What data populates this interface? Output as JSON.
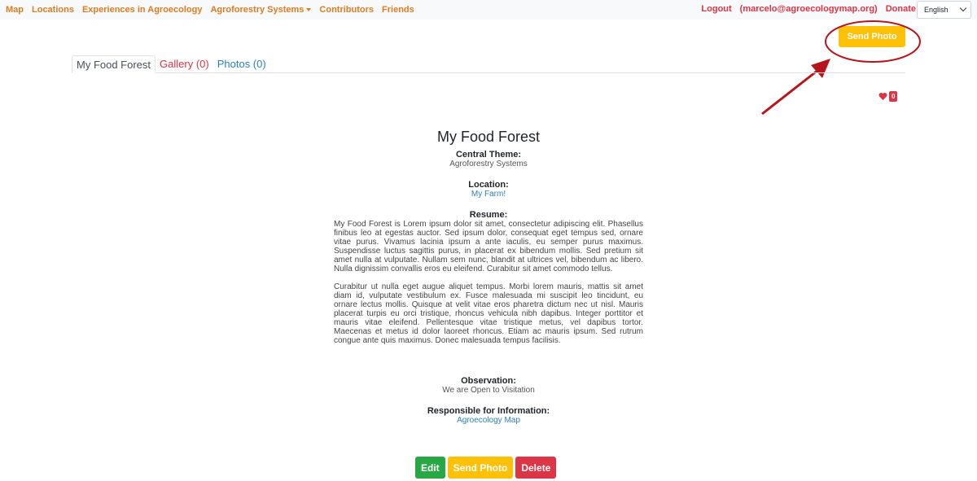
{
  "nav": {
    "left": [
      "Map",
      "Locations",
      "Experiences in Agroecology",
      "Agroforestry Systems",
      "Contributors",
      "Friends"
    ],
    "logout": "Logout",
    "user": "(marcelo@agroecologymap.org)",
    "donate": "Donate",
    "language": "English"
  },
  "top_button": "Send Photo",
  "tabs": [
    "My Food Forest",
    "Gallery (0)",
    "Photos (0)"
  ],
  "likes": "0",
  "detail": {
    "title": "My Food Forest",
    "theme_label": "Central Theme:",
    "theme_value": "Agroforestry Systems",
    "location_label": "Location:",
    "location_value": "My Farm!",
    "resume_label": "Resume:",
    "resume_p1": "My Food Forest is Lorem ipsum dolor sit amet, consectetur adipiscing elit. Phasellus finibus leo at egestas auctor. Sed ipsum dolor, consequat eget tempus sed, ornare vitae purus. Vivamus lacinia ipsum a ante iaculis, eu semper purus maximus. Suspendisse luctus sagittis purus, in placerat ex bibendum mollis. Sed pretium sit amet nulla at vulputate. Nullam sem nunc, blandit at ultrices vel, bibendum ac libero. Nulla dignissim convallis eros eu eleifend. Curabitur sit amet commodo tellus.",
    "resume_p2": "Curabitur ut nulla eget augue aliquet tempus. Morbi lorem mauris, mattis sit amet diam id, vulputate vestibulum ex. Fusce malesuada mi suscipit leo tincidunt, eu ornare lectus mollis. Quisque at velit vitae eros pharetra dictum nec ut nisl. Mauris placerat turpis eu orci tristique, rhoncus vehicula nibh dapibus. Integer porttitor et mauris vitae eleifend. Pellentesque vitae tristique metus, vel dapibus tortor. Maecenas et metus id dolor laoreet rhoncus. Etiam ac mauris ipsum. Sed rutrum congue ante quis maximus. Donec malesuada tempus facilisis.",
    "observation_label": "Observation:",
    "observation_value": "We are Open to Visitation",
    "responsible_label": "Responsible for Information:",
    "responsible_value": "Agroecology Map"
  },
  "actions": {
    "edit": "Edit",
    "send_photo": "Send Photo",
    "delete": "Delete"
  },
  "colors": {
    "nav_link": "#e07b1f",
    "danger": "#dc3545",
    "warning": "#ffc107",
    "success": "#28a745",
    "annotation": "#b7151c"
  }
}
